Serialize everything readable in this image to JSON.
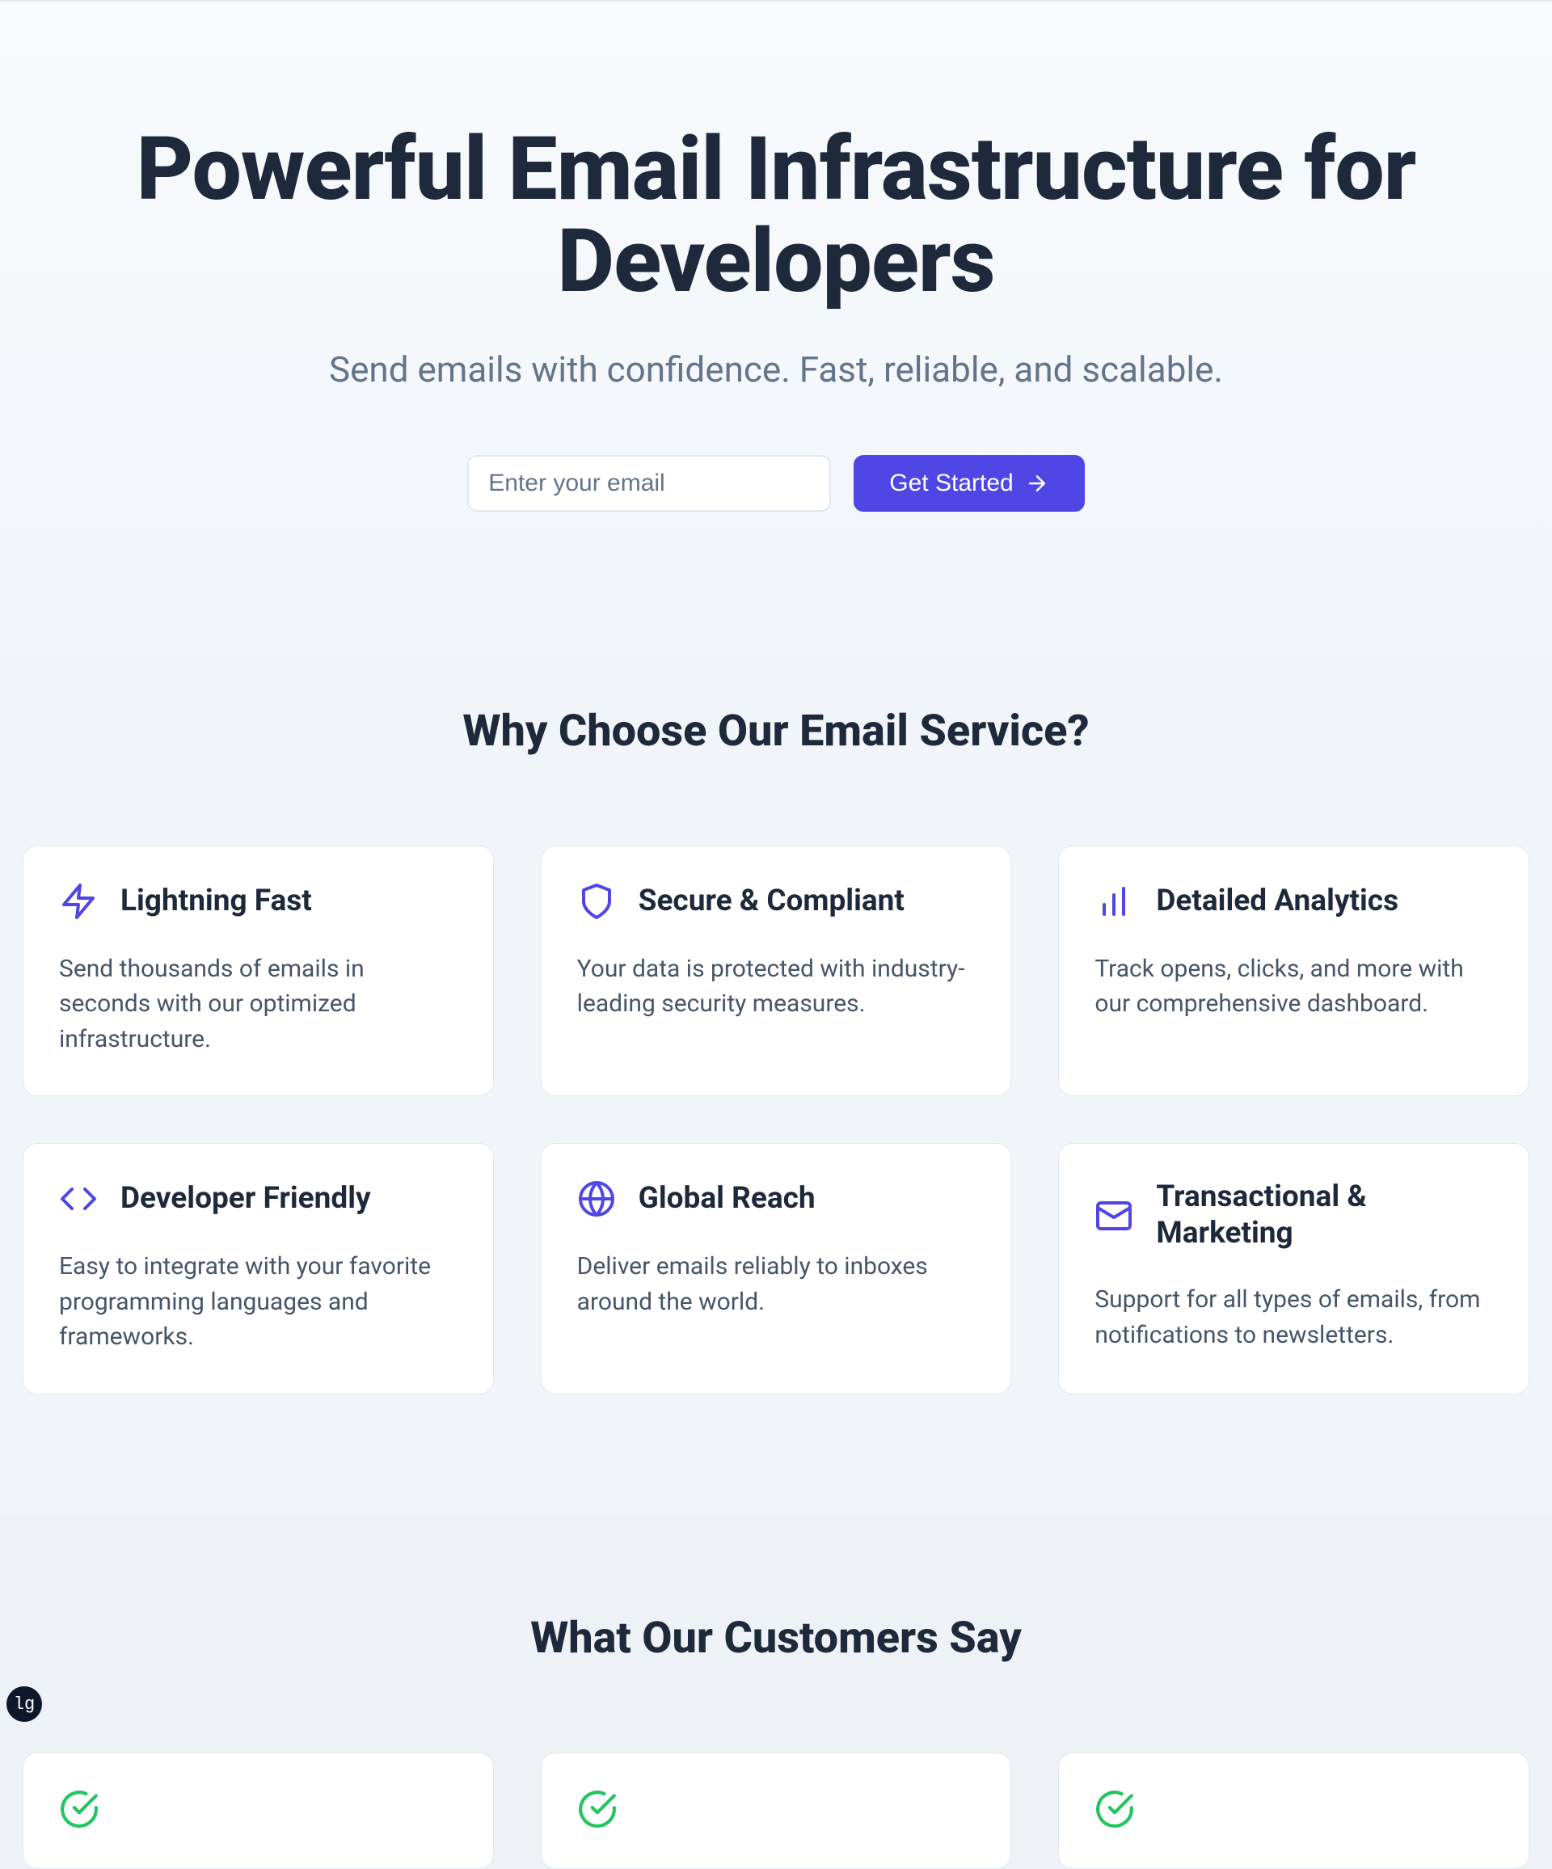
{
  "hero": {
    "title": "Powerful Email Infrastructure for Developers",
    "subtitle": "Send emails with confidence. Fast, reliable, and scalable.",
    "email_placeholder": "Enter your email",
    "cta_label": "Get Started"
  },
  "features": {
    "heading": "Why Choose Our Email Service?",
    "items": [
      {
        "icon": "zap",
        "title": "Lightning Fast",
        "desc": "Send thousands of emails in seconds with our optimized infrastructure."
      },
      {
        "icon": "shield",
        "title": "Secure & Compliant",
        "desc": "Your data is protected with industry-leading security measures."
      },
      {
        "icon": "bars",
        "title": "Detailed Analytics",
        "desc": "Track opens, clicks, and more with our comprehensive dashboard."
      },
      {
        "icon": "code",
        "title": "Developer Friendly",
        "desc": "Easy to integrate with your favorite programming languages and frameworks."
      },
      {
        "icon": "globe",
        "title": "Global Reach",
        "desc": "Deliver emails reliably to inboxes around the world."
      },
      {
        "icon": "mail",
        "title": "Transactional & Marketing",
        "desc": "Support for all types of emails, from notifications to newsletters."
      }
    ]
  },
  "testimonials": {
    "heading": "What Our Customers Say"
  },
  "breakpoint_badge": "lg"
}
